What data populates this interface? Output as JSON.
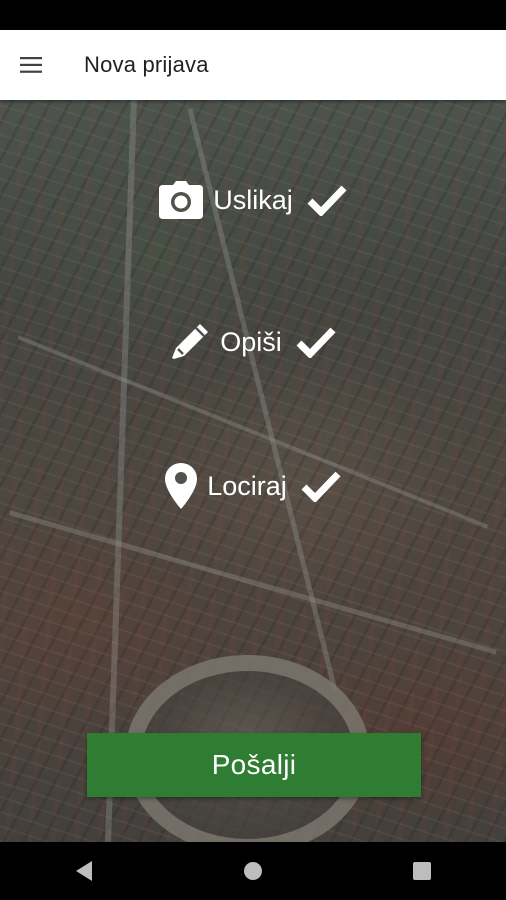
{
  "app_bar": {
    "title": "Nova prijava",
    "menu_icon": "hamburger-menu-icon"
  },
  "steps": [
    {
      "label": "Uslikaj",
      "icon": "camera-icon",
      "done": true
    },
    {
      "label": "Opiši",
      "icon": "pencil-icon",
      "done": true
    },
    {
      "label": "Lociraj",
      "icon": "map-marker-icon",
      "done": true
    }
  ],
  "submit": {
    "label": "Pošalji",
    "color": "#2e7d32"
  },
  "nav": {
    "back_icon": "back-triangle-icon",
    "home_icon": "home-circle-icon",
    "recents_icon": "recents-square-icon"
  },
  "colors": {
    "primary_green": "#2e7d32",
    "app_bar_bg": "#ffffff",
    "system_bars": "#000000"
  }
}
